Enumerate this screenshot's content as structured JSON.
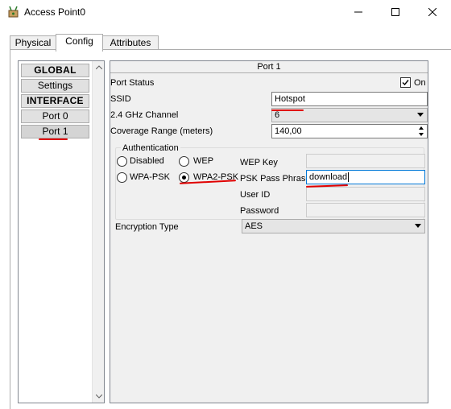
{
  "window": {
    "title": "Access Point0",
    "app_icon": "packet-tracer-device-icon",
    "controls": {
      "minimize": "minimize-icon",
      "maximize": "maximize-icon",
      "close": "close-icon"
    }
  },
  "tabs": [
    {
      "label": "Physical"
    },
    {
      "label": "Config",
      "active": true
    },
    {
      "label": "Attributes"
    }
  ],
  "sidebar": {
    "items": [
      {
        "label": "GLOBAL",
        "header": true
      },
      {
        "label": "Settings"
      },
      {
        "label": "INTERFACE",
        "header": true
      },
      {
        "label": "Port 0"
      },
      {
        "label": "Port 1",
        "selected": true
      }
    ]
  },
  "port": {
    "title": "Port 1",
    "status_label": "Port Status",
    "status_checked": true,
    "status_on_label": "On",
    "ssid_label": "SSID",
    "ssid_value": "Hotspot",
    "channel_label": "2.4 GHz Channel",
    "channel_value": "6",
    "coverage_label": "Coverage Range (meters)",
    "coverage_value": "140,00",
    "auth": {
      "group_label": "Authentication",
      "disabled_label": "Disabled",
      "wep_label": "WEP",
      "wpa_psk_label": "WPA-PSK",
      "wpa2_psk_label": "WPA2-PSK",
      "selected": "WPA2-PSK",
      "wep_key_label": "WEP Key",
      "psk_pass_label": "PSK Pass Phrase",
      "psk_pass_value": "download",
      "user_id_label": "User ID",
      "password_label": "Password"
    },
    "encryption_label": "Encryption Type",
    "encryption_value": "AES"
  },
  "colors": {
    "annotation_red": "#e00000",
    "focus_blue": "#0078d7",
    "pane_background": "#f0f0f0"
  }
}
